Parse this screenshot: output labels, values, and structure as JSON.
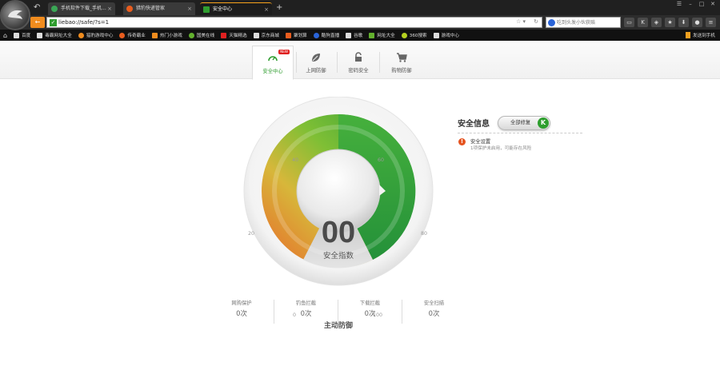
{
  "browser": {
    "tabs": [
      {
        "label": "手机软件下载_手机...",
        "icon_color": "#3aa655",
        "active": false
      },
      {
        "label": "猎豹快递管家",
        "icon_color": "#e95d1e",
        "active": false
      },
      {
        "label": "安全中心",
        "icon_color": "#2f9d2f",
        "active": true
      }
    ],
    "new_tab": "+",
    "url": "liebao://safe/?s=1",
    "search_placeholder": "吃到头发小伙获赔",
    "bookmarks": [
      {
        "label": "百度",
        "color": "#dddddd"
      },
      {
        "label": "毒霸网址大全",
        "color": "#dddddd"
      },
      {
        "label": "猎豹游戏中心",
        "color": "#f08c1e"
      },
      {
        "label": "传奇霸业",
        "color": "#e95d1e"
      },
      {
        "label": "热门小游戏",
        "color": "#f08c1e"
      },
      {
        "label": "国美在线",
        "color": "#63b12e"
      },
      {
        "label": "天猫精选",
        "color": "#e02020"
      },
      {
        "label": "京东商城",
        "color": "#dddddd"
      },
      {
        "label": "聚划算",
        "color": "#e95d1e"
      },
      {
        "label": "酷狗直播",
        "color": "#2a64d8"
      },
      {
        "label": "谷歌",
        "color": "#dddddd"
      },
      {
        "label": "网址大全",
        "color": "#63b12e"
      },
      {
        "label": "360搜索",
        "color": "#b5d020"
      },
      {
        "label": "游戏中心",
        "color": "#dddddd"
      }
    ],
    "send_to_phone": "发送到手机"
  },
  "page_tabs": [
    {
      "label": "安全中心",
      "icon": "gauge-icon",
      "badge": "NEW",
      "active": true
    },
    {
      "label": "上网防御",
      "icon": "shield-leaf-icon",
      "active": false
    },
    {
      "label": "密码安全",
      "icon": "lock-icon",
      "active": false
    },
    {
      "label": "购物防御",
      "icon": "cart-icon",
      "active": false
    }
  ],
  "gauge": {
    "score": "00",
    "score_label": "安全指数",
    "ticks": [
      "0",
      "20",
      "40",
      "60",
      "80",
      "100"
    ],
    "bottom_label": "主动防御",
    "colors": {
      "green": "#3aa93a",
      "orange": "#ea7a26",
      "yellow": "#c8d434"
    }
  },
  "stats": [
    {
      "label": "网购保护",
      "value": "0次"
    },
    {
      "label": "钓鱼拦截",
      "value": "0次"
    },
    {
      "label": "下载拦截",
      "value": "0次"
    },
    {
      "label": "安全扫描",
      "value": "0次"
    }
  ],
  "security_info": {
    "title": "安全信息",
    "fix_all": "全部修复",
    "fix_icon_letter": "K",
    "items": [
      {
        "title": "安全设置",
        "desc": "1项保护未启用，可能存在风险"
      }
    ]
  }
}
